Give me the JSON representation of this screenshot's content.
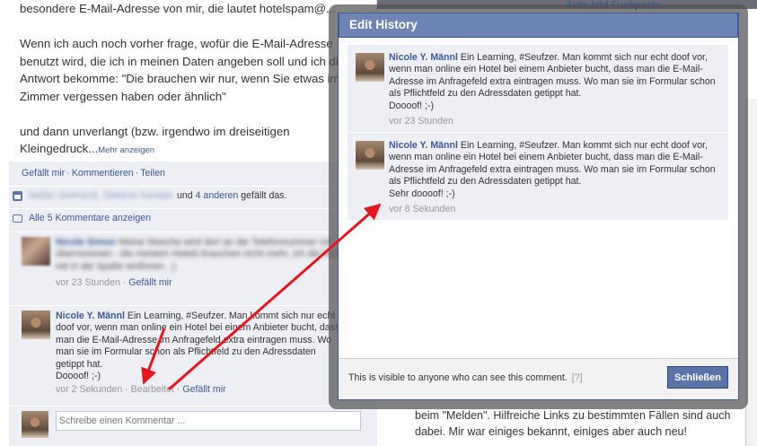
{
  "post": {
    "line1": "besondere E-Mail-Adresse von mir, die lautet hotelspam@...",
    "line2": "Wenn ich auch noch vorher frage, wofür die E-Mail-Adresse",
    "line3": "benutzt wird, die ich in meinen Daten angeben soll und ich die",
    "line4": "Antwort bekomme: \"Die brauchen wir nur, wenn Sie etwas im",
    "line5": "Zimmer vergessen haben oder ähnlich\"",
    "line6": "und dann unverlangt (bzw. irgendwo im dreiseitigen",
    "line7": "Kleingedruck...",
    "more_link": "Mehr anzeigen"
  },
  "actions": {
    "like": "Gefällt mir",
    "comment": "Kommentieren",
    "share": "Teilen"
  },
  "likes": {
    "blurred_names": "Stefan Gebhardt, Stefanie Kerstan",
    "others_prefix": "und",
    "others_link": "4 anderen",
    "suffix": "gefällt das."
  },
  "show_all_comments": "Alle 5 Kommentare anzeigen",
  "comment1": {
    "name_blurred": "Nicole Simon",
    "text_blurred": "Meine Wasche wird dort an die Telefonnummer mit übernommen - die meisten Hotels brauchen nicht mehr, ich die Mail mit in die Spalte einfinnen. ;)",
    "time": "vor 23 Stunden",
    "like": "Gefällt mir"
  },
  "comment2": {
    "name": "Nicole Y. Männl",
    "text": "Ein Learning, #Seufzer. Man kommt sich nur echt doof vor, wenn man online ein Hotel bei einem Anbieter bucht, dass man die E-Mail-Adresse im Anfragefeld extra eintragen muss. Wo man sie im Formular schon als Pflichtfeld zu den Adressdaten getippt hat.",
    "text_end": "Doooof! ;-)",
    "time": "vor 2 Sekunden",
    "edited": "Bearbeitet",
    "like": "Gefällt mir"
  },
  "write_comment_placeholder": "Schreibe einen Kommentar ...",
  "right_bg": {
    "top_link": "Auto bild Fuckposts",
    "bottom_line1": "beim \"Melden\". Hilfreiche Links zu bestimmten Fällen sind auch",
    "bottom_line2": "dabei. Mir war einiges bekannt, einiges aber auch neu!"
  },
  "dialog": {
    "title": "Edit History",
    "history": [
      {
        "name": "Nicole Y. Männl",
        "text": "Ein Learning, #Seufzer. Man kommt sich nur echt doof vor, wenn man online ein Hotel bei einem Anbieter bucht, dass man die E-Mail-Adresse im Anfragefeld extra eintragen muss. Wo man sie im Formular schon als Pflichtfeld zu den Adressdaten getippt hat.",
        "text_end": "Doooof! ;-)",
        "time": "vor 23 Stunden"
      },
      {
        "name": "Nicole Y. Männl",
        "text": "Ein Learning, #Seufzer. Man kommt sich nur echt doof vor, wenn man online ein Hotel bei einem Anbieter bucht, dass man die E-Mail-Adresse im Anfragefeld extra eintragen muss. Wo man sie im Formular schon als Pflichtfeld zu den Adressdaten getippt hat.",
        "text_end": "Sehr doooof! ;-)",
        "time": "vor 8 Sekunden"
      }
    ],
    "footer_note": "This is visible to anyone who can see this comment.",
    "help": "[?]",
    "close_button": "Schließen"
  },
  "annotation_arrow_color": "#e8141b",
  "link_color": "#3b5998"
}
